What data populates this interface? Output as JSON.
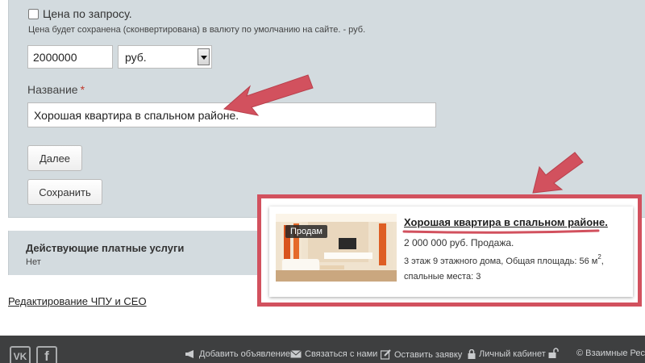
{
  "form": {
    "price_on_request_label": "Цена по запросу.",
    "price_note": "Цена будет сохранена (сконвертирована) в валюту по умолчанию на сайте. - руб.",
    "price_value": "2000000",
    "currency_selected": "руб.",
    "title_label": "Название",
    "required_mark": "*",
    "title_value": "Хорошая квартира в спальном районе.",
    "next_button": "Далее",
    "save_button": "Сохранить"
  },
  "services": {
    "title": "Действующие платные услуги",
    "value": "Нет"
  },
  "seo_link": "Редактирование ЧПУ и СЕО",
  "preview": {
    "badge": "Продам",
    "title": "Хорошая квартира в спальном районе.",
    "price": "2 000 000 руб. Продажа.",
    "details_line1": "3 этаж 9 этажного дома, Общая площадь: 56 м",
    "area_superscript": "2",
    "details_line1_suffix": ",",
    "details_line2": "спальные места: 3"
  },
  "footer": {
    "vk": "VK",
    "fb": "f",
    "add_ad": "Добавить объявление",
    "contact": "Связаться с нами",
    "leave_request": "Оставить заявку",
    "account": "Личный кабинет",
    "copyright": "© Взаимные Рес"
  },
  "colors": {
    "accent_red": "#d2515e",
    "panel_bg": "#d3dbdf",
    "footer_bg": "#3e3f40"
  },
  "icons": [
    "arrow-annotation-icon",
    "megaphone-icon",
    "envelope-icon",
    "pencil-icon",
    "lock-icon",
    "unlock-icon",
    "vk-icon",
    "facebook-icon"
  ]
}
